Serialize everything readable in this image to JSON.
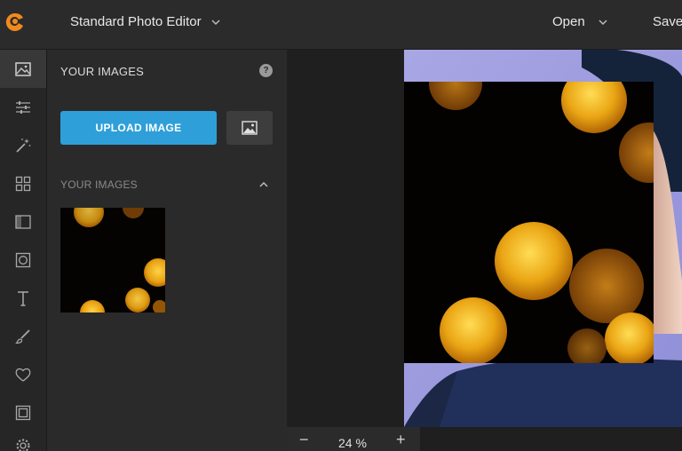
{
  "header": {
    "app_title": "Standard Photo Editor",
    "open_label": "Open",
    "save_label": "Save"
  },
  "toolbar": {
    "items": [
      {
        "icon": "image-icon",
        "active": true
      },
      {
        "icon": "sliders-icon"
      },
      {
        "icon": "magic-wand-icon"
      },
      {
        "icon": "grid-icon"
      },
      {
        "icon": "texture-icon"
      },
      {
        "icon": "frame-icon"
      },
      {
        "icon": "text-icon"
      },
      {
        "icon": "brush-icon"
      },
      {
        "icon": "heart-icon"
      },
      {
        "icon": "border-icon"
      },
      {
        "icon": "gear-icon"
      }
    ]
  },
  "panel": {
    "title": "YOUR IMAGES",
    "help_glyph": "?",
    "upload_label": "UPLOAD IMAGE",
    "section_title": "YOUR IMAGES"
  },
  "zoom": {
    "minus": "−",
    "value": "24 %",
    "plus": "+"
  },
  "colors": {
    "accent": "#2e9fd9",
    "topbar": "#2b2b2b",
    "panel": "#2a2a2a",
    "canvas": "#1f1f1f",
    "logo": "#f08a1c"
  }
}
